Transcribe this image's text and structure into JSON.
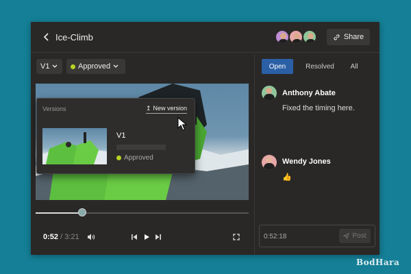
{
  "header": {
    "title": "Ice-Climb",
    "share_label": "Share",
    "avatar_colors": [
      "#c08fd6",
      "#e7a7a7",
      "#8fc79a"
    ]
  },
  "toolbar": {
    "version_selector": "V1",
    "status_selector": "Approved",
    "status_color": "#b7d324"
  },
  "versions_popover": {
    "heading": "Versions",
    "new_version_label": "New version",
    "items": [
      {
        "version": "V1",
        "status": "Approved"
      }
    ]
  },
  "player": {
    "current_time": "0:52",
    "separator": "/",
    "total_time": "3:21",
    "progress": 0.22
  },
  "comments_panel": {
    "tabs": [
      {
        "label": "Open",
        "active": true
      },
      {
        "label": "Resolved",
        "active": false
      },
      {
        "label": "All",
        "active": false
      }
    ],
    "comments": [
      {
        "author": "Anthony Abate",
        "text": "Fixed the timing here.",
        "avatar_color": "#8fc79a"
      },
      {
        "author": "Wendy Jones",
        "text": "👍",
        "avatar_color": "#e7a7a7"
      }
    ],
    "composer": {
      "timestamp": "0:52:18",
      "post_label": "Post"
    }
  },
  "watermark": {
    "brand": "BodHara"
  },
  "colors": {
    "background": "#147f96",
    "panel": "#2a2827",
    "accent": "#2b5fa6"
  }
}
